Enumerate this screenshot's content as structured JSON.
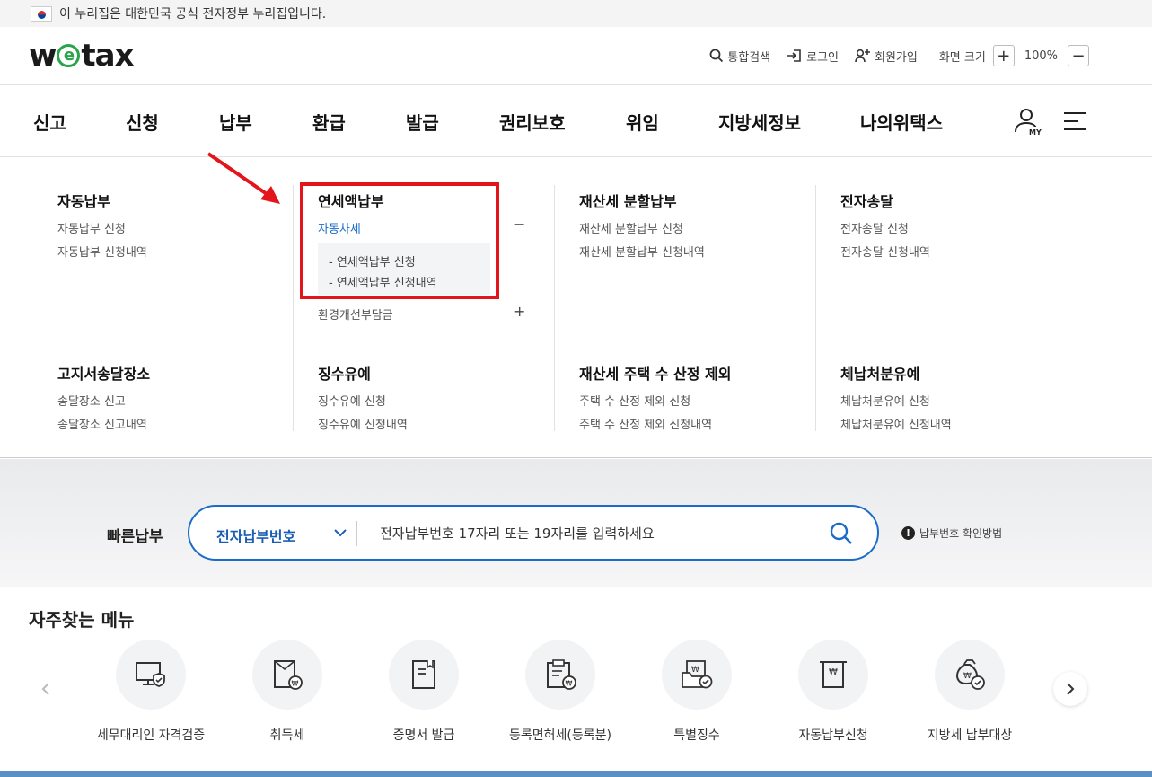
{
  "gov_banner": {
    "text": "이 누리집은 대한민국 공식 전자정부 누리집입니다.",
    "flag_icon": "korea-flag-icon"
  },
  "logo": {
    "pre": "w",
    "mid": "e",
    "post": "tax"
  },
  "utility": {
    "search": "통합검색",
    "login": "로그인",
    "signup": "회원가입",
    "zoom_label": "화면 크기",
    "zoom_in": "+",
    "zoom_value": "100%",
    "zoom_out": "−"
  },
  "nav": {
    "items": [
      "신고",
      "신청",
      "납부",
      "환급",
      "발급",
      "권리보호",
      "위임",
      "지방세정보",
      "나의위택스"
    ],
    "my_label": "MY"
  },
  "mega": {
    "groups": [
      {
        "title": "자동납부",
        "items": [
          "자동납부 신청",
          "자동납부 신청내역"
        ]
      },
      {
        "title": "연세액납부",
        "items": [
          "자동차세",
          "환경개선부담금"
        ],
        "expanded_sub": [
          "- 연세액납부 신청",
          "- 연세액납부 신청내역"
        ],
        "toggle_open": "−",
        "toggle_closed": "+"
      },
      {
        "title": "재산세 분할납부",
        "items": [
          "재산세 분할납부 신청",
          "재산세 분할납부 신청내역"
        ]
      },
      {
        "title": "전자송달",
        "items": [
          "전자송달 신청",
          "전자송달 신청내역"
        ]
      },
      {
        "title": "고지서송달장소",
        "items": [
          "송달장소 신고",
          "송달장소 신고내역"
        ]
      },
      {
        "title": "징수유예",
        "items": [
          "징수유예 신청",
          "징수유예 신청내역"
        ]
      },
      {
        "title": "재산세 주택 수 산정 제외",
        "items": [
          "주택 수 산정 제외 신청",
          "주택 수 산정 제외 신청내역"
        ]
      },
      {
        "title": "체납처분유예",
        "items": [
          "체납처분유예 신청",
          "체납처분유예 신청내역"
        ]
      }
    ]
  },
  "quick_pay": {
    "label": "빠른납부",
    "type": "전자납부번호",
    "placeholder": "전자납부번호 17자리 또는 19자리를 입력하세요",
    "help": "납부번호 확인방법"
  },
  "frequent": {
    "title": "자주찾는 메뉴",
    "items": [
      {
        "label": "세무대리인 자격검증",
        "icon": "monitor-shield-icon"
      },
      {
        "label": "취득세",
        "icon": "document-won-icon"
      },
      {
        "label": "증명서 발급",
        "icon": "certificate-icon"
      },
      {
        "label": "등록면허세(등록분)",
        "icon": "clipboard-won-icon"
      },
      {
        "label": "특별징수",
        "icon": "folder-won-check-icon"
      },
      {
        "label": "자동납부신청",
        "icon": "receipt-won-icon"
      },
      {
        "label": "지방세 납부대상",
        "icon": "money-bag-check-icon"
      }
    ]
  },
  "colors": {
    "accent": "#1a6cc8",
    "highlight": "#e4141b",
    "logo_green": "#2aa34a"
  }
}
